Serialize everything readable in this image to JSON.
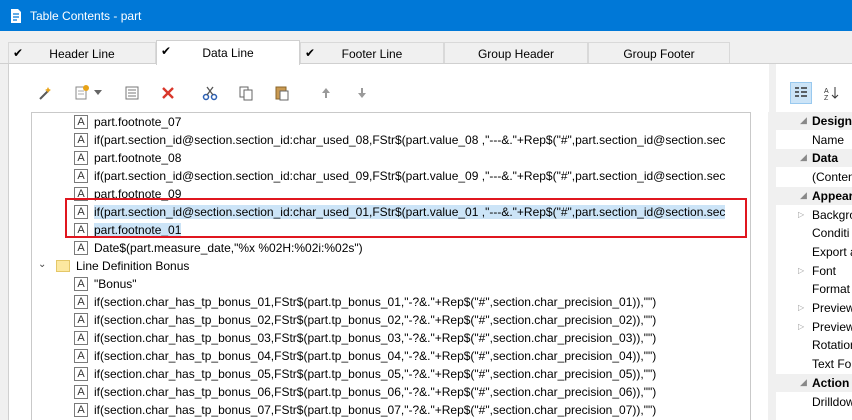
{
  "window": {
    "title": "Table Contents - part"
  },
  "tabs": [
    {
      "label": "Header Line",
      "checked": true,
      "active": false
    },
    {
      "label": "Data Line",
      "checked": true,
      "active": true
    },
    {
      "label": "Footer Line",
      "checked": true,
      "active": false
    },
    {
      "label": "Group Header",
      "checked": false,
      "active": false
    },
    {
      "label": "Group Footer",
      "checked": false,
      "active": false
    }
  ],
  "toolbar": {
    "icons": [
      "wizard-icon",
      "insert-icon",
      "dropdown-icon",
      "properties-icon",
      "delete-icon",
      "cut-icon",
      "copy-icon",
      "paste-icon",
      "move-up-icon",
      "move-down-icon"
    ]
  },
  "tree": {
    "rows": [
      {
        "type": "field",
        "text": "part.footnote_07"
      },
      {
        "type": "field",
        "text": "if(part.section_id@section.section_id:char_used_08,FStr$(part.value_08 ,\"---&.\"+Rep$(\"#\",part.section_id@section.sec"
      },
      {
        "type": "field",
        "text": "part.footnote_08"
      },
      {
        "type": "field",
        "text": "if(part.section_id@section.section_id:char_used_09,FStr$(part.value_09 ,\"---&.\"+Rep$(\"#\",part.section_id@section.sec"
      },
      {
        "type": "field",
        "text": "part.footnote_09"
      },
      {
        "type": "field",
        "text": "if(part.section_id@section.section_id:char_used_01,FStr$(part.value_01 ,\"---&.\"+Rep$(\"#\",part.section_id@section.sec",
        "selected": true
      },
      {
        "type": "field",
        "text": "part.footnote_01",
        "selected": true
      },
      {
        "type": "field",
        "text": "Date$(part.measure_date,\"%x  %02H:%02i:%02s\")"
      },
      {
        "type": "folder",
        "text": "Line Definition Bonus"
      },
      {
        "type": "field",
        "text": "\"Bonus\""
      },
      {
        "type": "field",
        "text": "if(section.char_has_tp_bonus_01,FStr$(part.tp_bonus_01,\"-?&.\"+Rep$(\"#\",section.char_precision_01)),\"\")"
      },
      {
        "type": "field",
        "text": "if(section.char_has_tp_bonus_02,FStr$(part.tp_bonus_02,\"-?&.\"+Rep$(\"#\",section.char_precision_02)),\"\")"
      },
      {
        "type": "field",
        "text": "if(section.char_has_tp_bonus_03,FStr$(part.tp_bonus_03,\"-?&.\"+Rep$(\"#\",section.char_precision_03)),\"\")"
      },
      {
        "type": "field",
        "text": "if(section.char_has_tp_bonus_04,FStr$(part.tp_bonus_04,\"-?&.\"+Rep$(\"#\",section.char_precision_04)),\"\")"
      },
      {
        "type": "field",
        "text": "if(section.char_has_tp_bonus_05,FStr$(part.tp_bonus_05,\"-?&.\"+Rep$(\"#\",section.char_precision_05)),\"\")"
      },
      {
        "type": "field",
        "text": "if(section.char_has_tp_bonus_06,FStr$(part.tp_bonus_06,\"-?&.\"+Rep$(\"#\",section.char_precision_06)),\"\")"
      },
      {
        "type": "field",
        "text": "if(section.char_has_tp_bonus_07,FStr$(part.tp_bonus_07,\"-?&.\"+Rep$(\"#\",section.char_precision_07)),\"\")"
      }
    ]
  },
  "properties": {
    "rows": [
      {
        "kind": "category",
        "label": "Design"
      },
      {
        "kind": "item",
        "label": "Name"
      },
      {
        "kind": "category",
        "label": "Data"
      },
      {
        "kind": "item",
        "label": "(Conten"
      },
      {
        "kind": "category",
        "label": "Appear"
      },
      {
        "kind": "expandable",
        "label": "Backgro"
      },
      {
        "kind": "item",
        "label": "Conditi"
      },
      {
        "kind": "item",
        "label": "Export a"
      },
      {
        "kind": "expandable",
        "label": "Font"
      },
      {
        "kind": "item",
        "label": "Format"
      },
      {
        "kind": "expandable",
        "label": "Preview"
      },
      {
        "kind": "expandable",
        "label": "Preview"
      },
      {
        "kind": "item",
        "label": "Rotation"
      },
      {
        "kind": "item",
        "label": "Text For"
      },
      {
        "kind": "category",
        "label": "Action"
      },
      {
        "kind": "item",
        "label": "Drilldow"
      }
    ]
  },
  "field_glyph": "A",
  "colors": {
    "titlebar": "#0078d7",
    "selection": "#cce4f7",
    "highlight_box": "#e0161f"
  }
}
